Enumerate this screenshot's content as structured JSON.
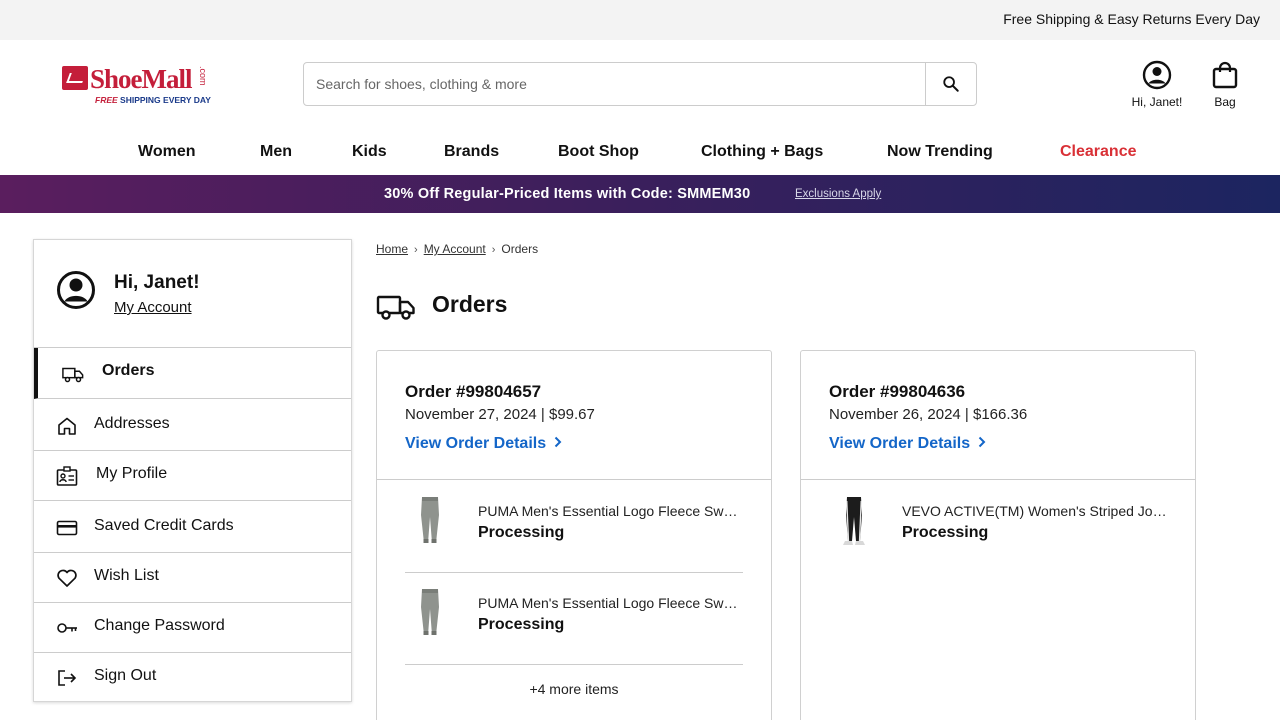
{
  "topbar": {
    "message": "Free Shipping & Easy Returns Every Day"
  },
  "logo": {
    "name": "ShoeMall",
    "suffix": ".com",
    "tag_free": "FREE",
    "tag_rest": "SHIPPING EVERY DAY"
  },
  "search": {
    "placeholder": "Search for shoes, clothing & more",
    "value": ""
  },
  "header": {
    "account_label": "Hi, Janet!",
    "bag_label": "Bag"
  },
  "nav": {
    "items": [
      "Women",
      "Men",
      "Kids",
      "Brands",
      "Boot Shop",
      "Clothing + Bags",
      "Now Trending",
      "Clearance"
    ]
  },
  "promo": {
    "text": "30% Off Regular-Priced Items with Code: SMMEM30",
    "exclusions": "Exclusions Apply"
  },
  "sidebar": {
    "greeting": "Hi, Janet!",
    "my_account": "My Account",
    "items": [
      {
        "label": "Orders",
        "icon": "truck-icon"
      },
      {
        "label": "Addresses",
        "icon": "home-icon"
      },
      {
        "label": "My Profile",
        "icon": "id-card-icon"
      },
      {
        "label": "Saved Credit Cards",
        "icon": "credit-card-icon"
      },
      {
        "label": "Wish List",
        "icon": "heart-icon"
      },
      {
        "label": "Change Password",
        "icon": "key-icon"
      },
      {
        "label": "Sign Out",
        "icon": "sign-out-icon"
      }
    ]
  },
  "breadcrumb": {
    "home": "Home",
    "account": "My Account",
    "current": "Orders"
  },
  "page": {
    "title": "Orders"
  },
  "orders": [
    {
      "number": "Order #99804657",
      "date_total": "November 27, 2024 | $99.67",
      "view_label": "View Order Details",
      "items": [
        {
          "name": "PUMA Men's Essential Logo Fleece Sweatpants",
          "status": "Processing"
        },
        {
          "name": "PUMA Men's Essential Logo Fleece Sweatpants",
          "status": "Processing"
        }
      ],
      "more": "+4 more items"
    },
    {
      "number": "Order #99804636",
      "date_total": "November 26, 2024 | $166.36",
      "view_label": "View Order Details",
      "items": [
        {
          "name": "VEVO ACTIVE(TM) Women's Striped Jogger",
          "status": "Processing"
        }
      ]
    }
  ],
  "colors": {
    "brand_red": "#c41e3a",
    "link_blue": "#1466c8",
    "clearance_red": "#d93036",
    "promo_start": "#5a1e5e",
    "promo_end": "#1c2560"
  }
}
